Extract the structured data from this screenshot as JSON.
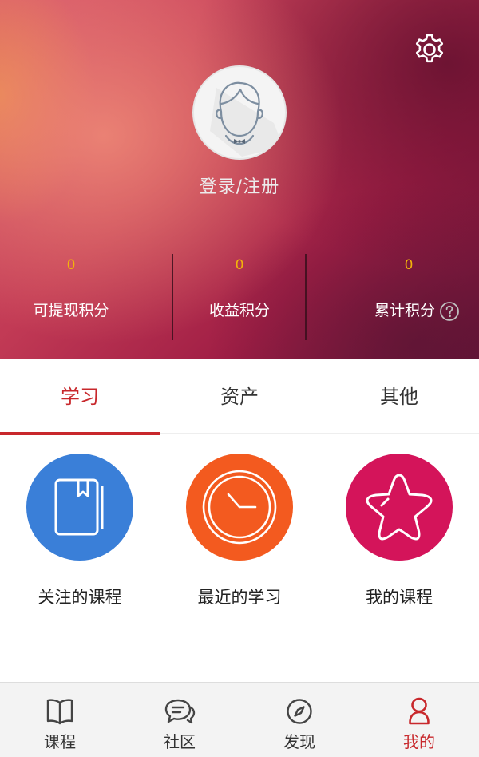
{
  "header": {
    "settings_icon": "gear-icon",
    "avatar_icon": "user-avatar-placeholder-icon",
    "login_label": "登录/注册",
    "stats": [
      {
        "value": "0",
        "label": "可提现积分"
      },
      {
        "value": "0",
        "label": "收益积分"
      },
      {
        "value": "0",
        "label": "累计积分",
        "help_icon": "question-circle-icon"
      }
    ]
  },
  "tabs": [
    {
      "label": "学习",
      "active": true
    },
    {
      "label": "资产",
      "active": false
    },
    {
      "label": "其他",
      "active": false
    }
  ],
  "grid": [
    {
      "label": "关注的课程",
      "icon": "bookmark-book-icon",
      "color": "#3a7fd8"
    },
    {
      "label": "最近的学习",
      "icon": "clock-icon",
      "color": "#f35a1f"
    },
    {
      "label": "我的课程",
      "icon": "star-icon",
      "color": "#d4145a"
    }
  ],
  "bottom_nav": [
    {
      "label": "课程",
      "icon": "open-book-icon",
      "active": false
    },
    {
      "label": "社区",
      "icon": "chat-bubble-icon",
      "active": false
    },
    {
      "label": "发现",
      "icon": "compass-icon",
      "active": false
    },
    {
      "label": "我的",
      "icon": "person-icon",
      "active": true
    }
  ],
  "colors": {
    "accent": "#c8282c",
    "stat_value": "#f2b40a"
  }
}
